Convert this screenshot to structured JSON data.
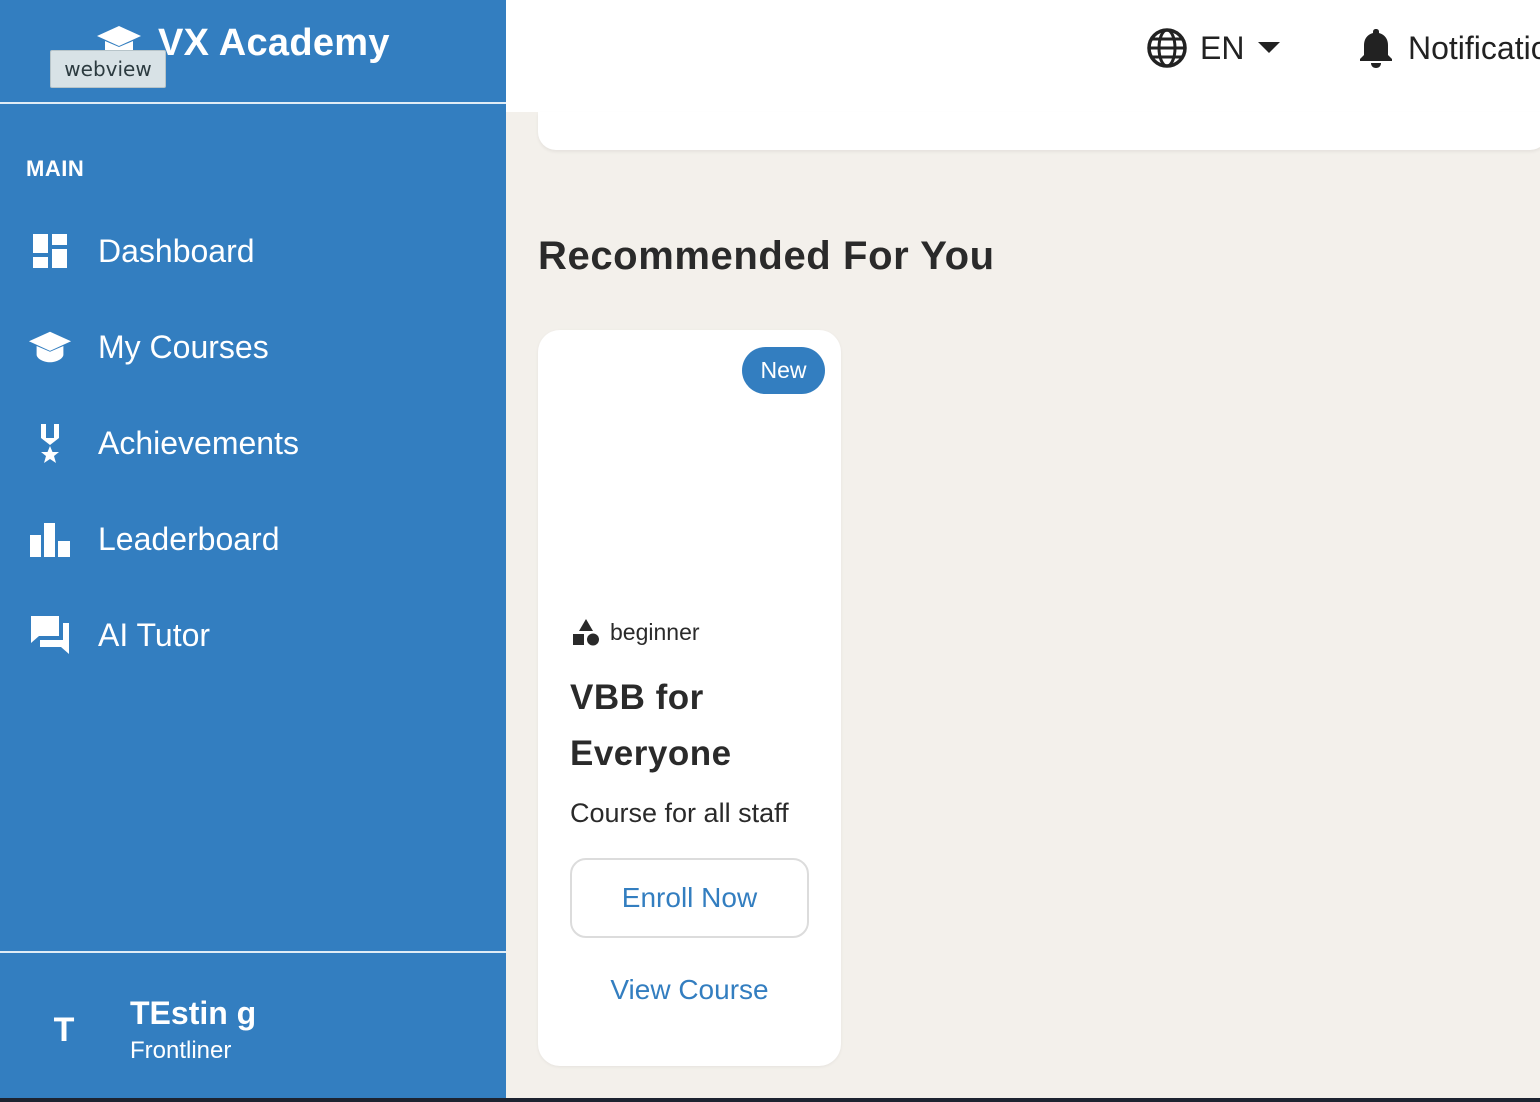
{
  "sidebar": {
    "brand_title": "VX Academy",
    "tooltip": "webview",
    "section_label": "MAIN",
    "items": [
      {
        "label": "Dashboard",
        "icon": "dashboard-icon"
      },
      {
        "label": "My Courses",
        "icon": "graduation-cap-icon"
      },
      {
        "label": "Achievements",
        "icon": "medal-icon"
      },
      {
        "label": "Leaderboard",
        "icon": "bar-chart-icon"
      },
      {
        "label": "AI Tutor",
        "icon": "chat-icon"
      }
    ],
    "user": {
      "initial": "T",
      "name": "TEstin g",
      "role": "Frontliner"
    }
  },
  "header": {
    "language": "EN",
    "notifications_label": "Notifications"
  },
  "main": {
    "heading": "Recommended For You",
    "course": {
      "badge": "New",
      "level": "beginner",
      "title": "VBB for Everyone",
      "description": "Course for all staff",
      "enroll_label": "Enroll Now",
      "view_label": "View Course"
    }
  },
  "colors": {
    "primary": "#337ec0",
    "background": "#f3f0eb",
    "text": "#2a2a2a"
  }
}
